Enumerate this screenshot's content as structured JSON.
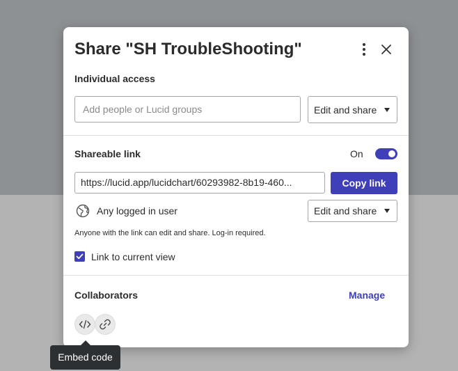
{
  "dialog": {
    "title": "Share \"SH TroubleShooting\"",
    "more_icon": "kebab-vertical-icon",
    "close_icon": "close-icon"
  },
  "individual_access": {
    "label": "Individual access",
    "input_placeholder": "Add people or Lucid groups",
    "input_value": "",
    "permission": "Edit and share"
  },
  "shareable_link": {
    "label": "Shareable link",
    "toggle_label": "On",
    "toggle_on": true,
    "url": "https://lucid.app/lucidchart/60293982-8b19-460...",
    "copy_label": "Copy link",
    "access_icon": "globe-icon",
    "access_scope": "Any logged in user",
    "permission": "Edit and share",
    "note": "Anyone with the link can edit and share. Log-in required.",
    "link_current_view_label": "Link to current view",
    "link_current_view_checked": true
  },
  "collaborators": {
    "label": "Collaborators",
    "manage_label": "Manage",
    "buttons": [
      {
        "icon": "code-icon"
      },
      {
        "icon": "link-icon"
      }
    ]
  },
  "tooltip": {
    "text": "Embed code"
  },
  "colors": {
    "accent": "#3e3fb9",
    "tooltip_bg": "#2d3033",
    "backdrop_top": "#8e9194",
    "backdrop_bottom": "#b3b3b3"
  }
}
